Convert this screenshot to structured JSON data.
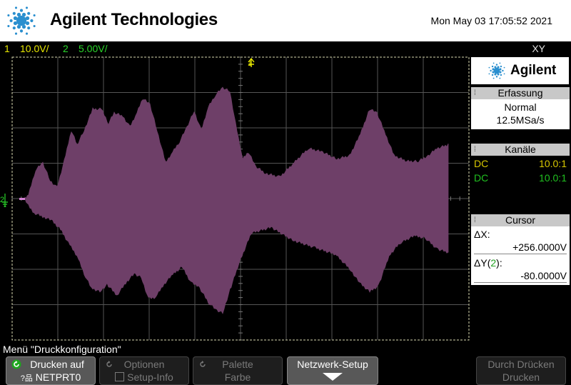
{
  "header": {
    "brand": "Agilent Technologies",
    "datetime": "Mon May 03 17:05:52 2021"
  },
  "status": {
    "ch1_num": "1",
    "ch1_scale": "10.0V/",
    "ch2_num": "2",
    "ch2_scale": "5.00V/",
    "mode": "XY"
  },
  "scope": {
    "trigger_marker": "1",
    "ground_marker": "2",
    "trace_color": "#6e3f68"
  },
  "panel": {
    "logo_text": "Agilent",
    "acquisition": {
      "title": "Erfassung",
      "mode": "Normal",
      "rate": "12.5MSa/s"
    },
    "channels": {
      "title": "Kanäle",
      "rows": [
        {
          "coupling": "DC",
          "probe": "10.0:1",
          "color": "#d8c800"
        },
        {
          "coupling": "DC",
          "probe": "10.0:1",
          "color": "#20c020"
        }
      ]
    },
    "cursor": {
      "title": "Cursor",
      "dx_label": "ΔX:",
      "dx_value": "+256.0000V",
      "dy_label": "ΔY(",
      "dy_channel": "2",
      "dy_close": "):",
      "dy_value": "-80.0000V"
    }
  },
  "menu": {
    "title": "Menü \"Druckkonfiguration\"",
    "softkeys": {
      "print_to": {
        "line1": "Drucken auf",
        "line2": "NETPRT0"
      },
      "options": {
        "line1": "Optionen",
        "line2": "Setup-Info"
      },
      "palette": {
        "line1": "Palette",
        "line2": "Farbe"
      },
      "network": {
        "line1": "Netzwerk-Setup"
      },
      "print": {
        "line1": "Durch Drücken",
        "line2": "Drucken"
      }
    }
  }
}
